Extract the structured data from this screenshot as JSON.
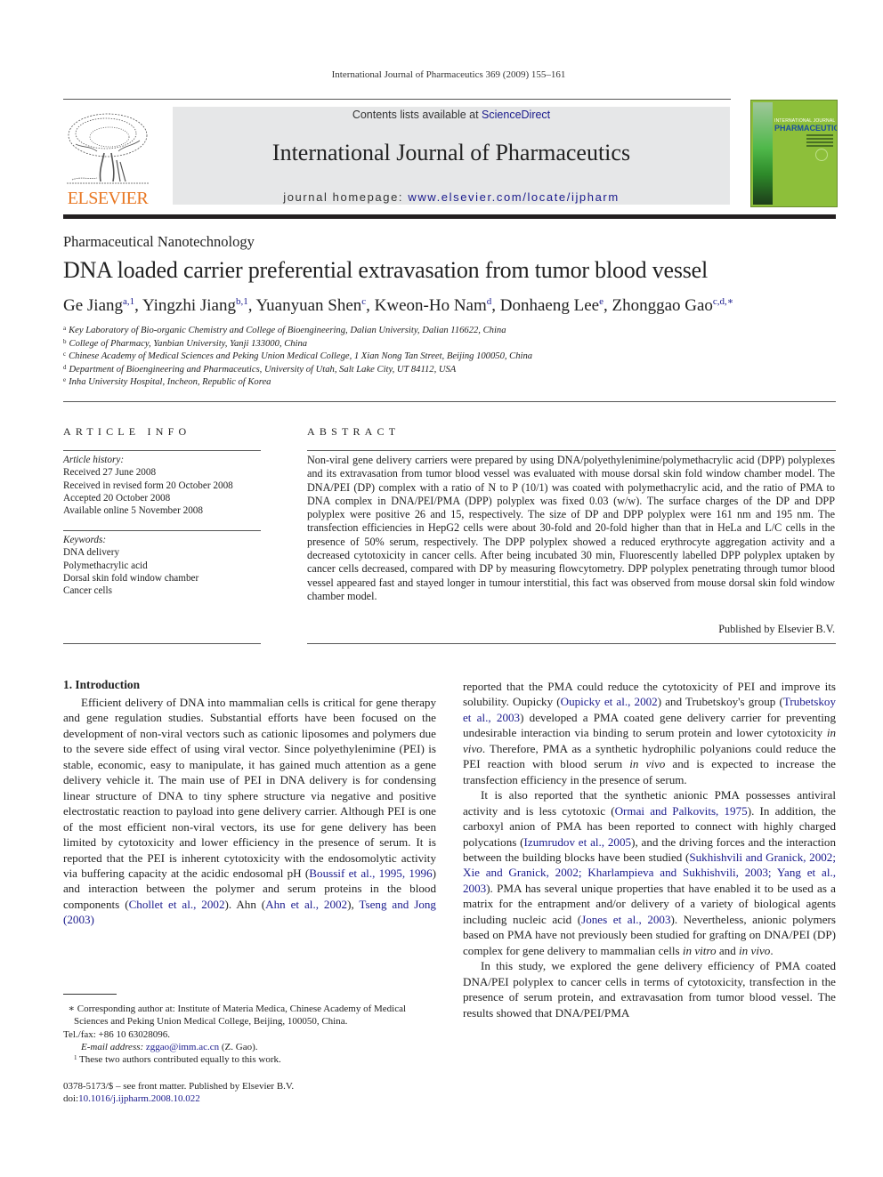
{
  "running_head": "International Journal of Pharmaceutics 369 (2009) 155–161",
  "masthead": {
    "contents_prefix": "Contents lists available at ",
    "contents_link": "ScienceDirect",
    "journal_title": "International Journal of Pharmaceutics",
    "homepage_prefix": "journal homepage: ",
    "homepage_link": "www.elsevier.com/locate/ijpharm",
    "publisher_logo": "ELSEVIER",
    "cover_line1": "INTERNATIONAL JOURNAL OF",
    "cover_line2": "PHARMACEUTICS",
    "colors": {
      "elsevier_orange": "#e87722",
      "link_blue": "#1a1a8c",
      "cover_green": "#8dbf3a",
      "masthead_gray": "#e6e7e8"
    }
  },
  "section_label": "Pharmaceutical Nanotechnology",
  "article_title": "DNA loaded carrier preferential extravasation from tumor blood vessel",
  "authors": [
    {
      "name": "Ge Jiang",
      "sup": "a,1",
      "sep": ", "
    },
    {
      "name": "Yingzhi Jiang",
      "sup": "b,1",
      "sep": ", "
    },
    {
      "name": "Yuanyuan Shen",
      "sup": "c",
      "sep": ", "
    },
    {
      "name": "Kweon-Ho Nam",
      "sup": "d",
      "sep": ", "
    },
    {
      "name": "Donhaeng Lee",
      "sup": "e",
      "sep": ", "
    },
    {
      "name": "Zhonggao Gao",
      "sup": "c,d,∗",
      "sep": ""
    }
  ],
  "affiliations": [
    {
      "mark": "a",
      "text": "Key Laboratory of Bio-organic Chemistry and College of Bioengineering, Dalian University, Dalian 116622, China"
    },
    {
      "mark": "b",
      "text": "College of Pharmacy, Yanbian University, Yanji 133000, China"
    },
    {
      "mark": "c",
      "text": "Chinese Academy of Medical Sciences and Peking Union Medical College, 1 Xian Nong Tan Street, Beijing 100050, China"
    },
    {
      "mark": "d",
      "text": "Department of Bioengineering and Pharmaceutics, University of Utah, Salt Lake City, UT 84112, USA"
    },
    {
      "mark": "e",
      "text": "Inha University Hospital, Incheon, Republic of Korea"
    }
  ],
  "article_info": {
    "heading": "ARTICLE INFO",
    "history_label": "Article history:",
    "history": [
      "Received 27 June 2008",
      "Received in revised form 20 October 2008",
      "Accepted 20 October 2008",
      "Available online 5 November 2008"
    ],
    "keywords_label": "Keywords:",
    "keywords": [
      "DNA delivery",
      "Polymethacrylic acid",
      "Dorsal skin fold window chamber",
      "Cancer cells"
    ]
  },
  "abstract": {
    "heading": "ABSTRACT",
    "text": "Non-viral gene delivery carriers were prepared by using DNA/polyethylenimine/polymethacrylic acid (DPP) polyplexes and its extravasation from tumor blood vessel was evaluated with mouse dorsal skin fold window chamber model. The DNA/PEI (DP) complex with a ratio of N to P (10/1) was coated with polymethacrylic acid, and the ratio of PMA to DNA complex in DNA/PEI/PMA (DPP) polyplex was fixed 0.03 (w/w). The surface charges of the DP and DPP polyplex were positive 26 and 15, respectively. The size of DP and DPP polyplex were 161 nm and 195 nm. The transfection efficiencies in HepG2 cells were about 30-fold and 20-fold higher than that in HeLa and L/C cells in the presence of 50% serum, respectively. The DPP polyplex showed a reduced erythrocyte aggregation activity and a decreased cytotoxicity in cancer cells. After being incubated 30 min, Fluorescently labelled DPP polyplex uptaken by cancer cells decreased, compared with DP by measuring flowcytometry. DPP polyplex penetrating through tumor blood vessel appeared fast and stayed longer in tumour interstitial, this fact was observed from mouse dorsal skin fold window chamber model.",
    "publisher_note": "Published by Elsevier B.V."
  },
  "intro": {
    "heading": "1.  Introduction",
    "left_p1": [
      {
        "t": "Efficient delivery of DNA into mammalian cells is critical for gene therapy and gene regulation studies. Substantial efforts have been focused on the development of non-viral vectors such as cationic liposomes and polymers due to the severe side effect of using viral vector. Since polyethylenimine (PEI) is stable, economic, easy to manipulate, it has gained much attention as a gene delivery vehicle it. The main use of PEI in DNA delivery is for condensing linear structure of DNA to tiny sphere structure via negative and positive electrostatic reaction to payload into gene delivery carrier. Although PEI is one of the most efficient non-viral vectors, its use for gene delivery has been limited by cytotoxicity and lower efficiency in the presence of serum. It is reported that the PEI is inherent cytotoxicity with the endosomolytic activity via buffering capacity at the acidic endosomal pH ("
      },
      {
        "t": "Boussif et al., 1995, 1996",
        "link": true
      },
      {
        "t": ") and interaction between the polymer and serum proteins in the blood components ("
      },
      {
        "t": "Chollet et al., 2002",
        "link": true
      },
      {
        "t": "). Ahn ("
      },
      {
        "t": "Ahn et al., 2002",
        "link": true
      },
      {
        "t": "), "
      },
      {
        "t": "Tseng and Jong (2003)",
        "link": true
      }
    ],
    "right_p1": [
      {
        "t": "reported that the PMA could reduce the cytotoxicity of PEI and improve its solubility. Oupicky ("
      },
      {
        "t": "Oupicky et al., 2002",
        "link": true
      },
      {
        "t": ") and Trubetskoy's group ("
      },
      {
        "t": "Trubetskoy et al., 2003",
        "link": true
      },
      {
        "t": ") developed a PMA coated gene delivery carrier for preventing undesirable interaction via binding to serum protein and lower cytotoxicity "
      },
      {
        "t": "in vivo",
        "ital": true
      },
      {
        "t": ". Therefore, PMA as a synthetic hydrophilic polyanions could reduce the PEI reaction with blood serum "
      },
      {
        "t": "in vivo",
        "ital": true
      },
      {
        "t": " and is expected to increase the transfection efficiency in the presence of serum."
      }
    ],
    "right_p2": [
      {
        "t": "It is also reported that the synthetic anionic PMA possesses antiviral activity and is less cytotoxic ("
      },
      {
        "t": "Ormai and Palkovits, 1975",
        "link": true
      },
      {
        "t": "). In addition, the carboxyl anion of PMA has been reported to connect with highly charged polycations ("
      },
      {
        "t": "Izumrudov et al., 2005",
        "link": true
      },
      {
        "t": "), and the driving forces and the interaction between the building blocks have been studied ("
      },
      {
        "t": "Sukhishvili and Granick, 2002; Xie and Granick, 2002; Kharlampieva and Sukhishvili, 2003; Yang et al., 2003",
        "link": true
      },
      {
        "t": "). PMA has several unique properties that have enabled it to be used as a matrix for the entrapment and/or delivery of a variety of biological agents including nucleic acid ("
      },
      {
        "t": "Jones et al., 2003",
        "link": true
      },
      {
        "t": "). Nevertheless, anionic polymers based on PMA have not previously been studied for grafting on DNA/PEI (DP) complex for gene delivery to mammalian cells "
      },
      {
        "t": "in vitro",
        "ital": true
      },
      {
        "t": " and "
      },
      {
        "t": "in vivo",
        "ital": true
      },
      {
        "t": "."
      }
    ],
    "right_p3": [
      {
        "t": "In this study, we explored the gene delivery efficiency of PMA coated DNA/PEI polyplex to cancer cells in terms of cytotoxicity, transfection in the presence of serum protein, and extravasation from tumor blood vessel. The results showed that DNA/PEI/PMA"
      }
    ]
  },
  "footnotes": {
    "corresponding": "∗  Corresponding author at: Institute of Materia Medica, Chinese Academy of Medical Sciences and Peking Union Medical College, Beijing, 100050, China.",
    "telfax": "Tel./fax: +86 10 63028096.",
    "email_label": "E-mail address: ",
    "email": "zggao@imm.ac.cn",
    "email_suffix": " (Z. Gao).",
    "equal_mark": "1",
    "equal_text": " These two authors contributed equally to this work.",
    "issn": "0378-5173/$ – see front matter. Published by Elsevier B.V.",
    "doi_label": "doi:",
    "doi": "10.1016/j.ijpharm.2008.10.022"
  }
}
